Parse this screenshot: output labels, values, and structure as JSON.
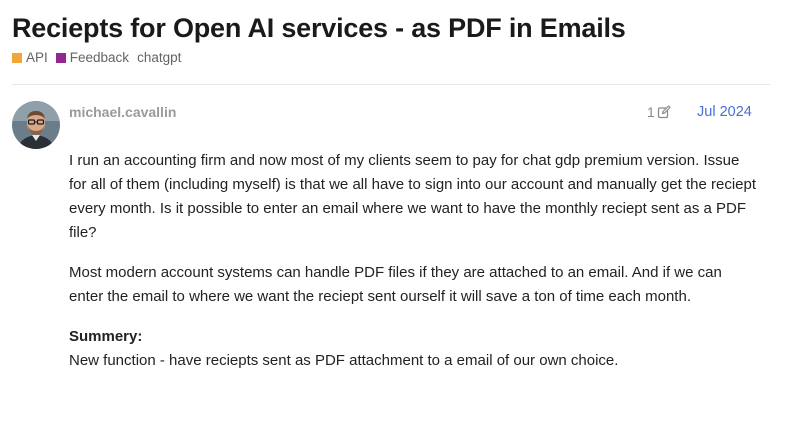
{
  "topic": {
    "title": "Reciepts for Open AI services - as PDF in Emails",
    "categories": [
      {
        "label": "API",
        "color": "#f0a638"
      },
      {
        "label": "Feedback",
        "color": "#92278f"
      }
    ],
    "tags": [
      "chatgpt"
    ]
  },
  "post": {
    "username": "michael.cavallin",
    "edit_count": "1",
    "edit_icon": "pencil-icon",
    "date": "Jul 2024",
    "paragraphs": [
      "I run an accounting firm and now most of my clients seem to pay for chat gdp premium version. Issue for all of them (including myself) is that we all have to sign into our account and manually get the reciept every month. Is it possible to enter an email where we want to have the monthly reciept sent as a PDF file?",
      "Most modern account systems can handle PDF files if they are attached to an email. And if we can enter the email to where we want the reciept sent ourself it will save a ton of time each month."
    ],
    "summary_heading": "Summery:",
    "summary_text": "New function - have reciepts sent as PDF attachment to a email of our own choice."
  },
  "colors": {
    "link": "#4a6fd6",
    "muted": "#9a9a9a"
  }
}
